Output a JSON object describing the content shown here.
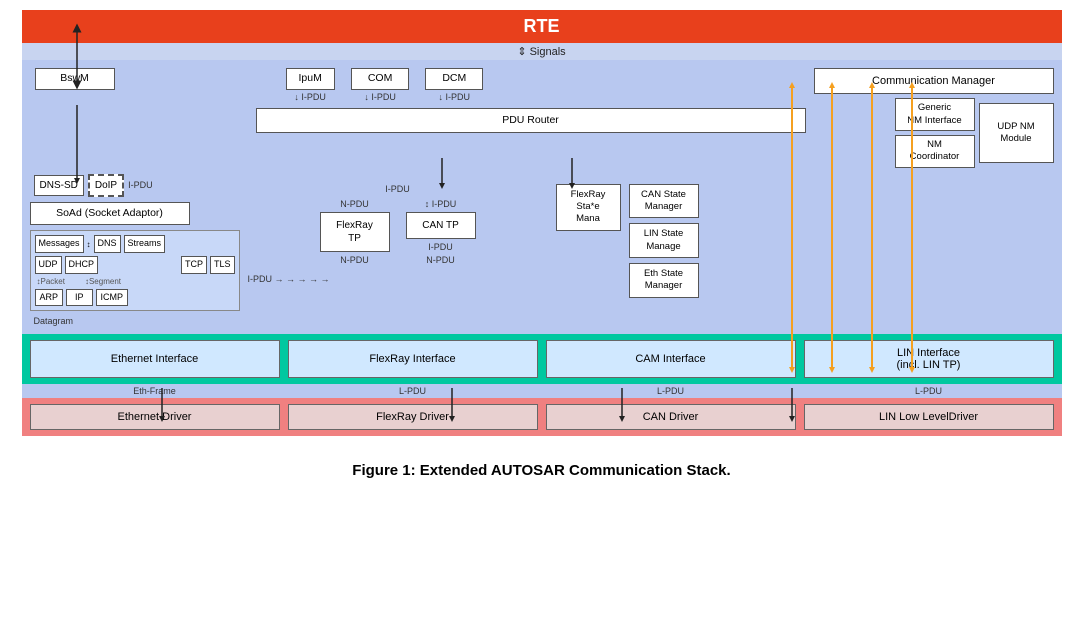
{
  "rte": {
    "label": "RTE",
    "signals_label": "⇕ Signals"
  },
  "diagram": {
    "title": "Figure 1: Extended AUTOSAR Communication Stack.",
    "top_boxes": [
      {
        "id": "bswm",
        "label": "BswM"
      },
      {
        "id": "ipum",
        "label": "IpuM"
      },
      {
        "id": "com",
        "label": "COM"
      },
      {
        "id": "dcm",
        "label": "DCM"
      },
      {
        "id": "comm",
        "label": "Communication Manager"
      }
    ],
    "pdu_router": {
      "label": "PDU  Router"
    },
    "mid_boxes": [
      {
        "id": "dns-sd",
        "label": "DNS-SD"
      },
      {
        "id": "doip",
        "label": "DoIP",
        "dashed": true
      },
      {
        "id": "soad",
        "label": "SoAd (Socket Adaptor)"
      },
      {
        "id": "flexray-tp",
        "label": "FlexRay\nTP"
      },
      {
        "id": "can-tp",
        "label": "CAN TP"
      },
      {
        "id": "flexray-state",
        "label": "FlexRay\nSta*e\nMana"
      },
      {
        "id": "can-state",
        "label": "CAN State\nManager"
      },
      {
        "id": "lin-state",
        "label": "LIN State\nManage"
      },
      {
        "id": "eth-state",
        "label": "Eth State\nManager"
      },
      {
        "id": "generic-nm",
        "label": "Generic\nNM Interface"
      },
      {
        "id": "nm-coord",
        "label": "NM\nCoordinator"
      },
      {
        "id": "udp-nm",
        "label": "UDP NM\nModule"
      }
    ],
    "protocol_boxes": [
      {
        "id": "messages",
        "label": "Messages"
      },
      {
        "id": "dns",
        "label": "DNS"
      },
      {
        "id": "streams",
        "label": "Streams"
      },
      {
        "id": "udp",
        "label": "UDP"
      },
      {
        "id": "dhcp",
        "label": "DHCP"
      },
      {
        "id": "tcp",
        "label": "TCP"
      },
      {
        "id": "tls",
        "label": "TLS"
      },
      {
        "id": "arp",
        "label": "ARP"
      },
      {
        "id": "ip",
        "label": "IP"
      },
      {
        "id": "icmp",
        "label": "ICMP"
      }
    ],
    "pdu_labels": [
      "I-PDU",
      "I-PDU",
      "I-PDU",
      "I-PDU",
      "N-PDU",
      "I-PDU",
      "N-PDU",
      "L-PDU",
      "L-PDU",
      "L-PDU"
    ],
    "interface_boxes": [
      {
        "id": "eth-iface",
        "label": "Ethernet Interface"
      },
      {
        "id": "flexray-iface",
        "label": "FlexRay Interface"
      },
      {
        "id": "can-iface",
        "label": "CAM Interface"
      },
      {
        "id": "lin-iface",
        "label": "LIN Interface\n(incl. LIN TP)"
      }
    ],
    "driver_boxes": [
      {
        "id": "eth-driver",
        "label": "Ethernet Driver"
      },
      {
        "id": "flexray-driver",
        "label": "FlexRay Driver"
      },
      {
        "id": "can-driver",
        "label": "CAN Driver"
      },
      {
        "id": "lin-driver",
        "label": "LIN  Low LevelDriver"
      }
    ],
    "frame_labels": [
      {
        "label": "Eth-Frame"
      },
      {
        "label": "L-PDU"
      },
      {
        "label": "L-PDU"
      },
      {
        "label": "L-PDU"
      }
    ],
    "datagram_label": "Datagram",
    "packet_label": "↕Packet",
    "segment_label": "↕Segment"
  }
}
